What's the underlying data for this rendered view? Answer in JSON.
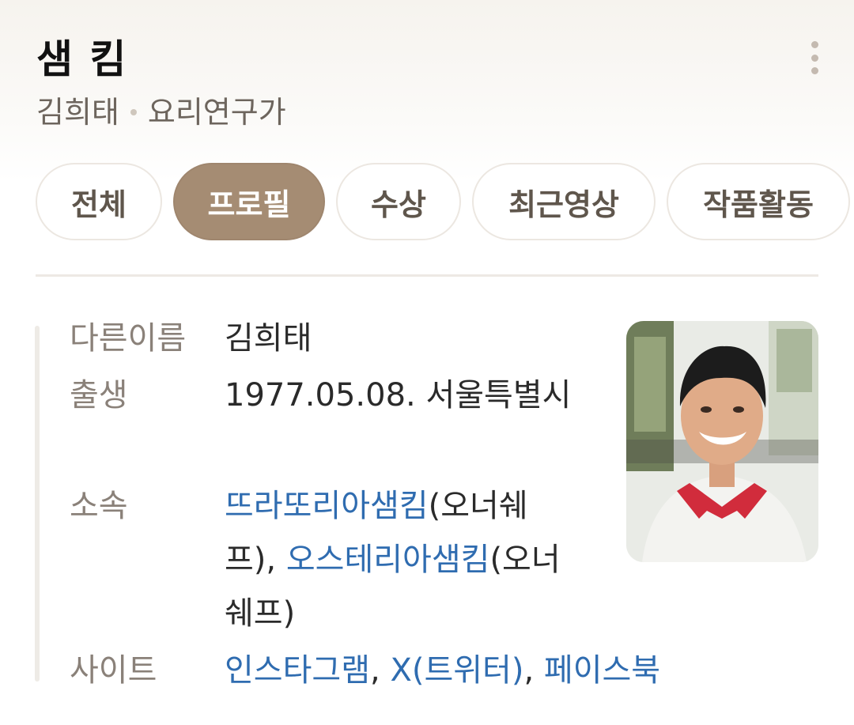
{
  "person": {
    "name": "샘 킴",
    "alias": "김희태",
    "occupation": "요리연구가"
  },
  "tabs": [
    {
      "label": "전체",
      "active": false
    },
    {
      "label": "프로필",
      "active": true
    },
    {
      "label": "수상",
      "active": false
    },
    {
      "label": "최근영상",
      "active": false
    },
    {
      "label": "작품활동",
      "active": false
    }
  ],
  "profile": {
    "other_name": {
      "label": "다른이름",
      "value": "김희태"
    },
    "birth": {
      "label": "출생",
      "value": "1977.05.08. 서울특별시"
    },
    "affiliation": {
      "label": "소속",
      "link1": "뜨라또리아샘킴",
      "text1": "(오너쉐프), ",
      "link2": "오스테리아샘킴",
      "text2": "(오너쉐프)"
    },
    "site": {
      "label": "사이트",
      "link1": "인스타그램",
      "sep1": ", ",
      "link2": "X(트위터)",
      "sep2": ", ",
      "link3": "페이스북"
    }
  },
  "icons": {
    "more": "more-vertical-icon"
  },
  "colors": {
    "active_tab": "#a58c73",
    "link": "#2f6cb0",
    "label": "#8a8179"
  }
}
